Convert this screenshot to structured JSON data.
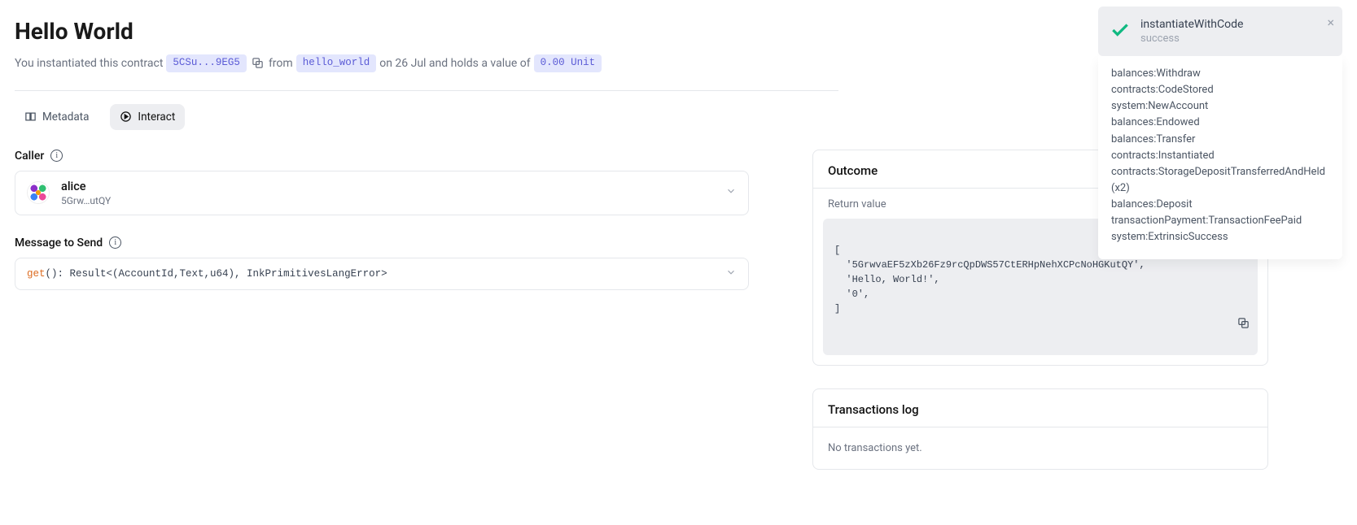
{
  "title": "Hello World",
  "subline_prefix": "You instantiated this contract",
  "address_short": "5CSu...9EG5",
  "subline_from": "from",
  "code_name": "hello_world",
  "subline_date": "on 26 Jul and holds a value of",
  "balance": "0.00 Unit",
  "tabs": {
    "metadata_label": "Metadata",
    "interact_label": "Interact"
  },
  "caller": {
    "label": "Caller",
    "name": "alice",
    "addr_short": "5Grw…utQY"
  },
  "message": {
    "label": "Message to Send",
    "fn": "get",
    "sig_rest": "(): Result<(AccountId,Text,u64), InkPrimitivesLangError>"
  },
  "outcome": {
    "header": "Outcome",
    "return_label": "Return value",
    "code": "[\n  '5GrwvaEF5zXb26Fz9rcQpDWS57CtERHpNehXCPcNoHGKutQY',\n  'Hello, World!',\n  '0',\n]"
  },
  "txlog": {
    "header": "Transactions log",
    "empty": "No transactions yet."
  },
  "toast": {
    "title": "instantiateWithCode",
    "status": "success",
    "events": [
      "balances:Withdraw",
      "contracts:CodeStored",
      "system:NewAccount",
      "balances:Endowed",
      "balances:Transfer",
      "contracts:Instantiated",
      "contracts:StorageDepositTransferredAndHeld (x2)",
      "balances:Deposit",
      "transactionPayment:TransactionFeePaid",
      "system:ExtrinsicSuccess"
    ]
  }
}
